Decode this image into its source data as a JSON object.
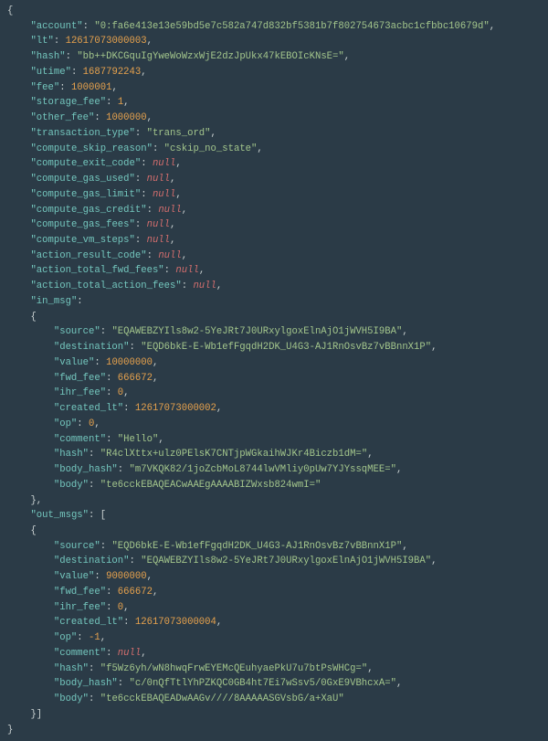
{
  "account": "0:fa6e413e13e59bd5e7c582a747d832bf5381b7f802754673acbc1cfbbc10679d",
  "lt": 12617073000003,
  "hash": "bb++DKCGquIgYweWoWzxWjE2dzJpUkx47kEBOIcKNsE=",
  "utime": 1687792243,
  "fee": 1000001,
  "storage_fee": 1,
  "other_fee": 1000000,
  "transaction_type": "trans_ord",
  "compute_skip_reason": "cskip_no_state",
  "compute_exit_code": null,
  "compute_gas_used": null,
  "compute_gas_limit": null,
  "compute_gas_credit": null,
  "compute_gas_fees": null,
  "compute_vm_steps": null,
  "action_result_code": null,
  "action_total_fwd_fees": null,
  "action_total_action_fees": null,
  "in_msg": {
    "source": "EQAWEBZYIls8w2-5YeJRt7J0URxylgoxElnAjO1jWVH5I9BA",
    "destination": "EQD6bkE-E-Wb1efFgqdH2DK_U4G3-AJ1RnOsvBz7vBBnnX1P",
    "value": 10000000,
    "fwd_fee": 666672,
    "ihr_fee": 0,
    "created_lt": 12617073000002,
    "op": 0,
    "comment": "Hello",
    "hash": "R4clXttx+ulz0PElsK7CNTjpWGkaihWJKr4Biczb1dM=",
    "body_hash": "m7VKQK82/1joZcbMoL8744lwVMliy0pUw7YJYssqMEE=",
    "body": "te6cckEBAQEACwAAEgAAAABIZWxsb824wmI="
  },
  "out_msgs": [
    {
      "source": "EQD6bkE-E-Wb1efFgqdH2DK_U4G3-AJ1RnOsvBz7vBBnnX1P",
      "destination": "EQAWEBZYIls8w2-5YeJRt7J0URxylgoxElnAjO1jWVH5I9BA",
      "value": 9000000,
      "fwd_fee": 666672,
      "ihr_fee": 0,
      "created_lt": 12617073000004,
      "op": -1,
      "comment": null,
      "hash": "f5Wz6yh/wN8hwqFrwEYEMcQEuhyaePkU7u7btPsWHCg=",
      "body_hash": "c/0nQfTtlYhPZKQC0GB4ht7Ei7wSsv5/0GxE9VBhcxA=",
      "body": "te6cckEBAQEADwAAGv////8AAAAASGVsbG/a+XaU"
    }
  ]
}
